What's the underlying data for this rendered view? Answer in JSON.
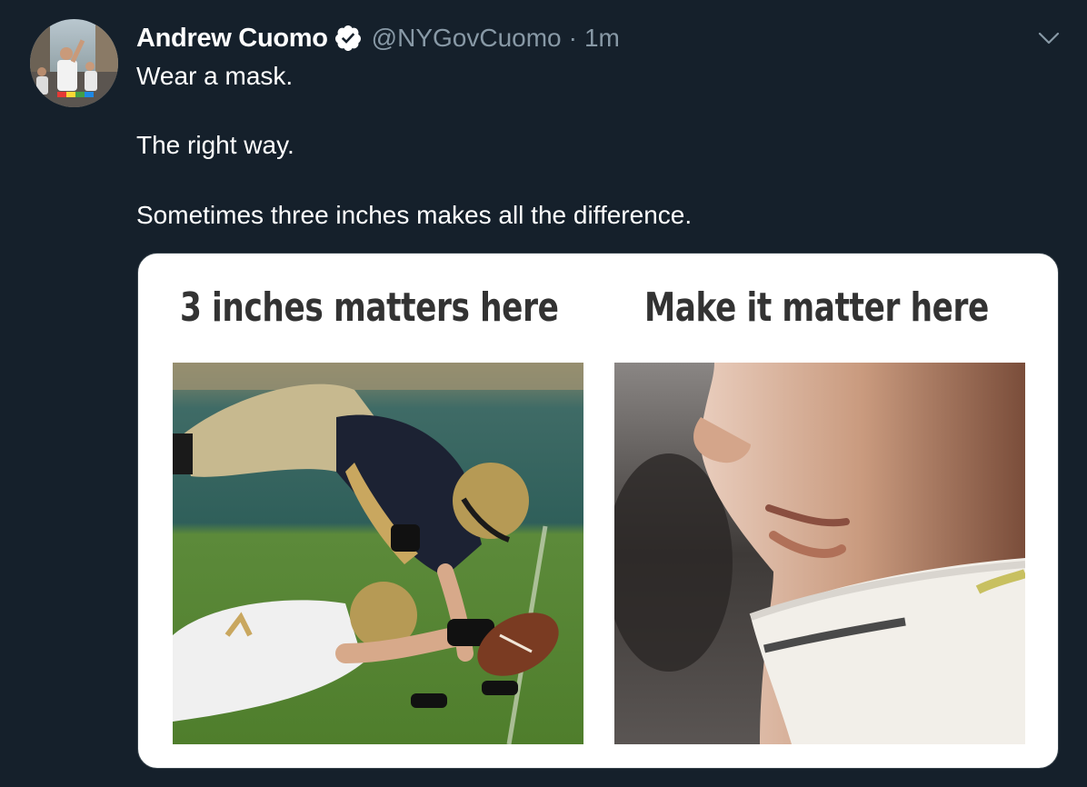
{
  "tweet": {
    "author": {
      "name": "Andrew Cuomo",
      "handle": "@NYGovCuomo",
      "verified": true
    },
    "separator": "·",
    "time": "1m",
    "lines": [
      "Wear a mask.",
      "The right way.",
      "Sometimes three inches makes all the difference."
    ],
    "media": {
      "left_caption": "3 inches matters here",
      "right_caption": "Make it matter here"
    }
  },
  "colors": {
    "background": "#15202b",
    "text": "#ffffff",
    "muted": "#8899a6",
    "card_border": "#38444d"
  },
  "icons": [
    "avatar-photo",
    "verified-badge-icon",
    "chevron-down-icon"
  ]
}
